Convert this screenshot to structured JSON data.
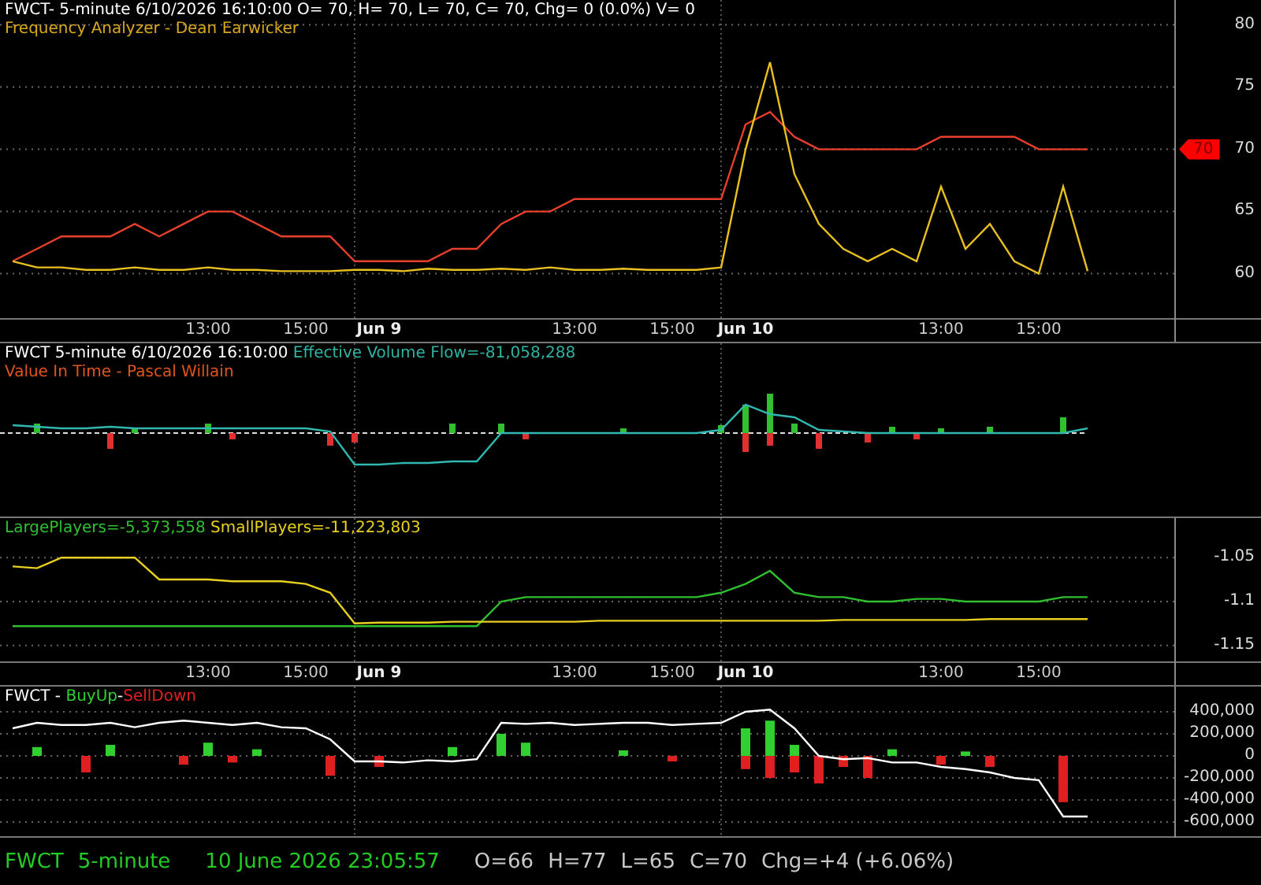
{
  "panels": [
    {
      "kind": "chart",
      "legend": [
        [
          {
            "text": "FWCT- 5-minute 6/10/2026 16:10:00 O= 70, H= 70, L= 70, C= 70, Chg= 0 (0.0%) V= 0",
            "color": "#ffffff"
          }
        ],
        [
          {
            "text": "Frequency Analyzer - Dean Earwicker",
            "color": "#d9a81e"
          }
        ]
      ],
      "price_tag": "70",
      "chart_data": {
        "type": "line",
        "grid": true,
        "categories": [
          null,
          null,
          null,
          null,
          null,
          null,
          null,
          null,
          "13:00",
          null,
          null,
          null,
          "15:00",
          null,
          null,
          "Jun 9",
          null,
          null,
          null,
          null,
          null,
          null,
          null,
          "13:00",
          null,
          null,
          null,
          "15:00",
          null,
          null,
          "Jun 10",
          null,
          null,
          null,
          null,
          null,
          null,
          null,
          "13:00",
          null,
          null,
          null,
          "15:00",
          null,
          null
        ],
        "ylim": [
          56.3,
          82
        ],
        "yticks": [
          60,
          65,
          70,
          75,
          80
        ],
        "series": [
          {
            "color": "#e8402a",
            "values": [
              61,
              62,
              63,
              63,
              63,
              64,
              63,
              64,
              65,
              65,
              64,
              63,
              63,
              63,
              61,
              61,
              61,
              61,
              62,
              62,
              64,
              65,
              65,
              66,
              66,
              66,
              66,
              66,
              66,
              66,
              72,
              73,
              71,
              70,
              70,
              70,
              70,
              70,
              71,
              71,
              71,
              71,
              70,
              70,
              70
            ]
          },
          {
            "color": "#e8c020",
            "values": [
              61,
              60.5,
              60.5,
              60.3,
              60.3,
              60.5,
              60.3,
              60.3,
              60.5,
              60.3,
              60.3,
              60.2,
              60.2,
              60.2,
              60.3,
              60.3,
              60.2,
              60.4,
              60.3,
              60.3,
              60.4,
              60.3,
              60.5,
              60.3,
              60.3,
              60.4,
              60.3,
              60.3,
              60.3,
              60.5,
              70,
              77,
              68,
              64,
              62,
              61,
              62,
              61,
              67,
              62,
              64,
              61,
              60,
              67,
              60.2
            ]
          }
        ]
      }
    },
    {
      "kind": "picture",
      "legend": [
        [
          {
            "text": "FWCT 5-minute  6/10/2026 16:10:00",
            "color": "#ffffff"
          },
          {
            "text": "Effective Volume Flow=-81,058,288",
            "color": "#2fb3a3"
          }
        ],
        [
          {
            "text": "Value In Time - Pascal Willain",
            "color": "#e0541e"
          }
        ]
      ]
    },
    {
      "kind": "chart",
      "legend": [
        [
          {
            "text": "LargePlayers=-5,373,558",
            "color": "#2fbf2f"
          },
          {
            "text": "SmallPlayers=-11,223,803",
            "color": "#e8d020"
          }
        ]
      ],
      "chart_data": {
        "type": "line",
        "grid": true,
        "categories": [
          null,
          null,
          null,
          null,
          null,
          null,
          null,
          null,
          "13:00",
          null,
          null,
          null,
          "15:00",
          null,
          null,
          "Jun 9",
          null,
          null,
          null,
          null,
          null,
          null,
          null,
          "13:00",
          null,
          null,
          null,
          "15:00",
          null,
          null,
          "Jun 10",
          null,
          null,
          null,
          null,
          null,
          null,
          null,
          "13:00",
          null,
          null,
          null,
          "15:00",
          null,
          null
        ],
        "ylim": [
          -1.17,
          -1.005
        ],
        "yticks": [
          {
            "value": -1.05,
            "label": "-1.05"
          },
          {
            "value": -1.1,
            "label": "-1.1"
          },
          {
            "value": -1.15,
            "label": "-1.15"
          }
        ],
        "series": [
          {
            "color": "#2fbf2f",
            "values": [
              -1.128,
              -1.128,
              -1.128,
              -1.128,
              -1.128,
              -1.128,
              -1.128,
              -1.128,
              -1.128,
              -1.128,
              -1.128,
              -1.128,
              -1.128,
              -1.128,
              -1.128,
              -1.128,
              -1.128,
              -1.128,
              -1.128,
              -1.128,
              -1.1,
              -1.095,
              -1.095,
              -1.095,
              -1.095,
              -1.095,
              -1.095,
              -1.095,
              -1.095,
              -1.09,
              -1.08,
              -1.065,
              -1.09,
              -1.095,
              -1.095,
              -1.1,
              -1.1,
              -1.097,
              -1.097,
              -1.1,
              -1.1,
              -1.1,
              -1.1,
              -1.095,
              -1.095
            ]
          },
          {
            "color": "#e8d020",
            "values": [
              -1.06,
              -1.062,
              -1.05,
              -1.05,
              -1.05,
              -1.05,
              -1.075,
              -1.075,
              -1.075,
              -1.077,
              -1.077,
              -1.077,
              -1.08,
              -1.09,
              -1.125,
              -1.124,
              -1.124,
              -1.124,
              -1.123,
              -1.123,
              -1.123,
              -1.123,
              -1.123,
              -1.123,
              -1.122,
              -1.122,
              -1.122,
              -1.122,
              -1.122,
              -1.122,
              -1.122,
              -1.122,
              -1.122,
              -1.122,
              -1.121,
              -1.121,
              -1.121,
              -1.121,
              -1.121,
              -1.121,
              -1.12,
              -1.12,
              -1.12,
              -1.12,
              -1.12
            ]
          }
        ]
      }
    },
    {
      "kind": "chart",
      "legend": [
        [
          {
            "text": "FWCT -",
            "color": "#ffffff"
          },
          {
            "text": "BuyUp",
            "color": "#30d030"
          },
          {
            "text": "-",
            "color": "#ffffff",
            "joined": true
          },
          {
            "text": "SellDown",
            "color": "#e02020",
            "joined": true
          }
        ]
      ],
      "chart_data": {
        "type": "bar",
        "grid": true,
        "categories": [
          null,
          null,
          null,
          null,
          null,
          null,
          null,
          null,
          null,
          null,
          null,
          null,
          null,
          null,
          null,
          null,
          null,
          null,
          null,
          null,
          null,
          null,
          null,
          null,
          null,
          null,
          null,
          null,
          null,
          null,
          null,
          null,
          null,
          null,
          null,
          null,
          null,
          null,
          null,
          null,
          null,
          null,
          null,
          null,
          null
        ],
        "ylim": [
          -743000,
          629000
        ],
        "yticks": [
          {
            "value": 400000,
            "label": "400,000"
          },
          {
            "value": 200000,
            "label": "200,000"
          },
          {
            "value": 0,
            "label": "0"
          },
          {
            "value": -200000,
            "label": "-200,000"
          },
          {
            "value": -400000,
            "label": "-400,000"
          },
          {
            "value": -600000,
            "label": "-600,000"
          }
        ],
        "series": [
          {
            "color": "#30d030",
            "values": [
              0,
              80000,
              0,
              0,
              100000,
              0,
              0,
              0,
              120000,
              0,
              60000,
              0,
              0,
              0,
              0,
              0,
              0,
              0,
              80000,
              0,
              200000,
              120000,
              0,
              0,
              0,
              50000,
              0,
              0,
              0,
              0,
              250000,
              320000,
              100000,
              0,
              0,
              0,
              60000,
              0,
              0,
              40000,
              0,
              0,
              0,
              0,
              0
            ]
          },
          {
            "color": "#e02020",
            "values": [
              0,
              0,
              0,
              -150000,
              0,
              0,
              0,
              -80000,
              0,
              -60000,
              0,
              0,
              0,
              -180000,
              0,
              -100000,
              0,
              0,
              0,
              0,
              0,
              0,
              0,
              0,
              0,
              0,
              0,
              -50000,
              0,
              0,
              -120000,
              -200000,
              -150000,
              -250000,
              -100000,
              -200000,
              0,
              0,
              -80000,
              0,
              -100000,
              0,
              0,
              -420000,
              0
            ]
          },
          {
            "type": "line",
            "color": "#ffffff",
            "values": [
              250000,
              300000,
              280000,
              280000,
              300000,
              260000,
              300000,
              320000,
              300000,
              280000,
              300000,
              260000,
              250000,
              150000,
              -50000,
              -50000,
              -60000,
              -40000,
              -50000,
              -30000,
              300000,
              290000,
              300000,
              280000,
              290000,
              300000,
              300000,
              280000,
              290000,
              300000,
              400000,
              420000,
              250000,
              0,
              -30000,
              -20000,
              -60000,
              -60000,
              -100000,
              -120000,
              -150000,
              -200000,
              -220000,
              -550000,
              -550000
            ]
          }
        ]
      }
    }
  ],
  "status_bar": [
    {
      "text": "FWCT",
      "color": "#22cc22"
    },
    {
      "text": "5-minute",
      "color": "#22cc22"
    },
    {
      "text": "10 June 2026 23:05:57",
      "color": "#22cc22"
    },
    {
      "text": "O=66",
      "color": "#c8c8c8"
    },
    {
      "text": "H=77",
      "color": "#c8c8c8"
    },
    {
      "text": "L=65",
      "color": "#c8c8c8"
    },
    {
      "text": "C=70",
      "color": "#c8c8c8"
    },
    {
      "text": "Chg=+4 (+6.06%)",
      "color": "#c8c8c8"
    }
  ]
}
